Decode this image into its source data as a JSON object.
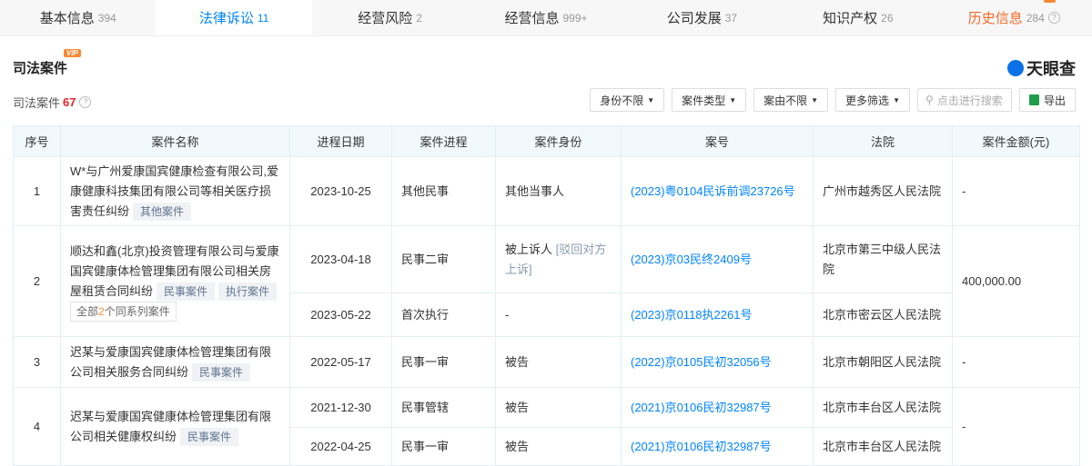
{
  "tabs": [
    {
      "label": "基本信息",
      "count": "394"
    },
    {
      "label": "法律诉讼",
      "count": "11"
    },
    {
      "label": "经营风险",
      "count": "2"
    },
    {
      "label": "经营信息",
      "count": "999+"
    },
    {
      "label": "公司发展",
      "count": "37"
    },
    {
      "label": "知识产权",
      "count": "26"
    },
    {
      "label": "历史信息",
      "count": "284"
    }
  ],
  "vip": "VIP",
  "section_title": "司法案件",
  "logo": "天眼查",
  "count_label": "司法案件",
  "count_value": "67",
  "filters": [
    "身份不限",
    "案件类型",
    "案由不限",
    "更多筛选"
  ],
  "search_placeholder": "点击进行搜索",
  "export": "导出",
  "columns": [
    "序号",
    "案件名称",
    "进程日期",
    "案件进程",
    "案件身份",
    "案号",
    "法院",
    "案件金额(元)"
  ],
  "rows": [
    {
      "no": "1",
      "name": "W*与广州爱康国宾健康检查有限公司,爱康健康科技集团有限公司等相关医疗损害责任纠纷",
      "tags": [
        "其他案件"
      ],
      "amount": "-",
      "subs": [
        {
          "date": "2023-10-25",
          "stage": "其他民事",
          "role": "其他当事人",
          "role_note": "",
          "case_no": "(2023)粤0104民诉前调23726号",
          "court": "广州市越秀区人民法院"
        }
      ]
    },
    {
      "no": "2",
      "name": "顺达和鑫(北京)投资管理有限公司与爱康国宾健康体检管理集团有限公司相关房屋租赁合同纠纷",
      "tags": [
        "民事案件",
        "执行案件"
      ],
      "series": {
        "pre": "全部",
        "n": "2",
        "post": "个同系列案件"
      },
      "amount": "400,000.00",
      "subs": [
        {
          "date": "2023-04-18",
          "stage": "民事二审",
          "role": "被上诉人",
          "role_note": "[驳回对方上诉]",
          "case_no": "(2023)京03民终2409号",
          "court": "北京市第三中级人民法院"
        },
        {
          "date": "2023-05-22",
          "stage": "首次执行",
          "role": "-",
          "role_note": "",
          "case_no": "(2023)京0118执2261号",
          "court": "北京市密云区人民法院"
        }
      ]
    },
    {
      "no": "3",
      "name": "迟某与爱康国宾健康体检管理集团有限公司相关服务合同纠纷",
      "tags": [
        "民事案件"
      ],
      "amount": "-",
      "subs": [
        {
          "date": "2022-05-17",
          "stage": "民事一审",
          "role": "被告",
          "role_note": "",
          "case_no": "(2022)京0105民初32056号",
          "court": "北京市朝阳区人民法院"
        }
      ]
    },
    {
      "no": "4",
      "name": "迟某与爱康国宾健康体检管理集团有限公司相关健康权纠纷",
      "tags": [
        "民事案件"
      ],
      "amount": "-",
      "subs": [
        {
          "date": "2021-12-30",
          "stage": "民事管辖",
          "role": "被告",
          "role_note": "",
          "case_no": "(2021)京0106民初32987号",
          "court": "北京市丰台区人民法院"
        },
        {
          "date": "2022-04-25",
          "stage": "民事一审",
          "role": "被告",
          "role_note": "",
          "case_no": "(2021)京0106民初32987号",
          "court": "北京市丰台区人民法院"
        }
      ]
    }
  ]
}
